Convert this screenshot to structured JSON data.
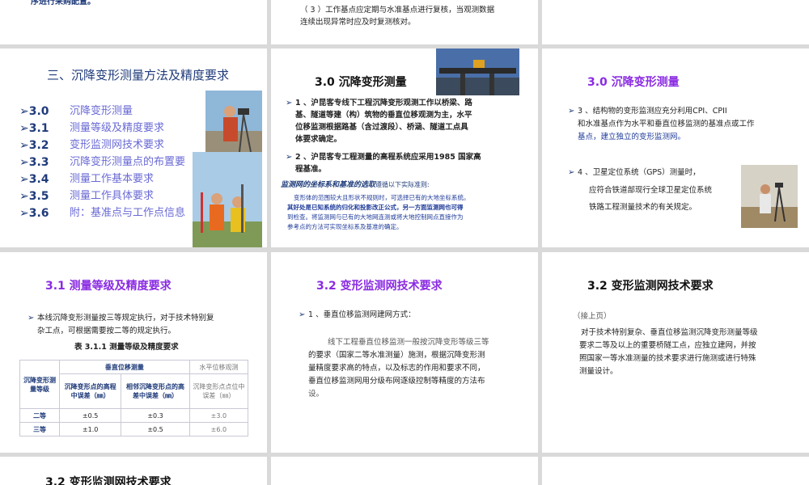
{
  "row0": {
    "s1_line": "序进行采购配置。",
    "s2_line1": "（ 3 ）工作基点应定期与水准基点进行复核，当观测数据",
    "s2_line2": "连续出现异常时应及时复测核对。"
  },
  "toc": {
    "title": "三、沉降变形测量方法及精度要求",
    "items": [
      {
        "num": "3.0",
        "label": "沉降变形测量"
      },
      {
        "num": "3.1",
        "label": "测量等级及精度要求"
      },
      {
        "num": "3.2",
        "label": "变形监测网技术要求"
      },
      {
        "num": "3.3",
        "label": "沉降变形测量点的布置要"
      },
      {
        "num": "3.4",
        "label": "测量工作基本要求"
      },
      {
        "num": "3.5",
        "label": "测量工作具体要求"
      },
      {
        "num": "3.6",
        "label": "附：基准点与工作点信息"
      }
    ]
  },
  "s30a": {
    "title": "3.0  沉降变形测量",
    "p1": [
      "1 、沪昆客专线下工程沉降变形观测工作以桥梁、路",
      "基、隧道等建（构）筑物的垂直位移观测为主，水平",
      "位移监测根据路基（含过渡段）、桥涵、隧道工点具",
      "体要求确定。"
    ],
    "p2": [
      "2 、沪昆客专工程测量的高程系统应采用1985 国家高",
      "程基准。"
    ],
    "p3_head": "监测网的坐标系和基准的选取",
    "p3_tail": "遵循以下实际准则:",
    "p3": [
      "变形体的范围较大且形状不规则时，可选择已有的大地坐标系统。",
      "其好处是已知系统的归化和投影改正公式，另一方面监测网也可得",
      "到检查。将监测网与已有的大地网连测或将大地控制网点直接作为",
      "参考点的方法可实现坐标系及基准的确定。"
    ]
  },
  "s30b": {
    "title": "3.0  沉降变形测量",
    "p1": [
      "3 、结构物的变形监测应充分利用CPI、CPII",
      "和水准基点作为水平和垂直位移监测的基准点或工作",
      "基点，建立独立的变形监测网。"
    ],
    "p2": [
      "4 、卫星定位系统（GPS）测量时，",
      "应符合铁道部现行全球卫星定位系统",
      "铁路工程测量技术的有关规定。"
    ]
  },
  "s31": {
    "title": "3.1   测量等级及精度要求",
    "p1": [
      "本线沉降变形测量按三等规定执行，对于技术特别复",
      "杂工点，可根据需要按二等的规定执行。"
    ],
    "caption": "表 3.1.1   测量等级及精度要求",
    "table": {
      "col0": "沉降变形测量等级",
      "group1": "垂直位移测量",
      "group2": "水平位移观测",
      "sub1": "沉降变形点的高程中误差（㎜）",
      "sub2": "相邻沉降变形点的高差中误差（㎜）",
      "sub3": "沉降变形点点位中误差（㎜）",
      "rows": [
        [
          "二等",
          "±0.5",
          "±0.3",
          "±3.0"
        ],
        [
          "三等",
          "±1.0",
          "±0.5",
          "±6.0"
        ]
      ]
    }
  },
  "s32a": {
    "title": "3.2   变形监测网技术要求",
    "item": "1 、垂直位移监测网建网方式：",
    "p": [
      "线下工程垂直位移监测一般按沉降变形等级三等",
      "的要求（国家二等水准测量）施测，根据沉降变形测",
      "量精度要求高的特点，以及标志的作用和要求不同，",
      "垂直位移监测网用分级布网逐级控制等精度的方法布",
      "设。"
    ]
  },
  "s32b": {
    "title": "3.2   变形监测网技术要求",
    "cont": "（接上页）",
    "p": [
      "对于技术特别复杂、垂直位移监测沉降变形测量等级",
      "要求二等及以上的重要桥隧工点，应独立建网，并按",
      "照国家一等水准测量的技术要求进行施测或进行特殊",
      "测量设计。"
    ]
  },
  "row3": {
    "title": "3.2   变形监测网技术要求"
  },
  "colors": {
    "navy": "#1f3b7a",
    "purple": "#8a2be2",
    "blue_text": "#1f3b9a"
  }
}
